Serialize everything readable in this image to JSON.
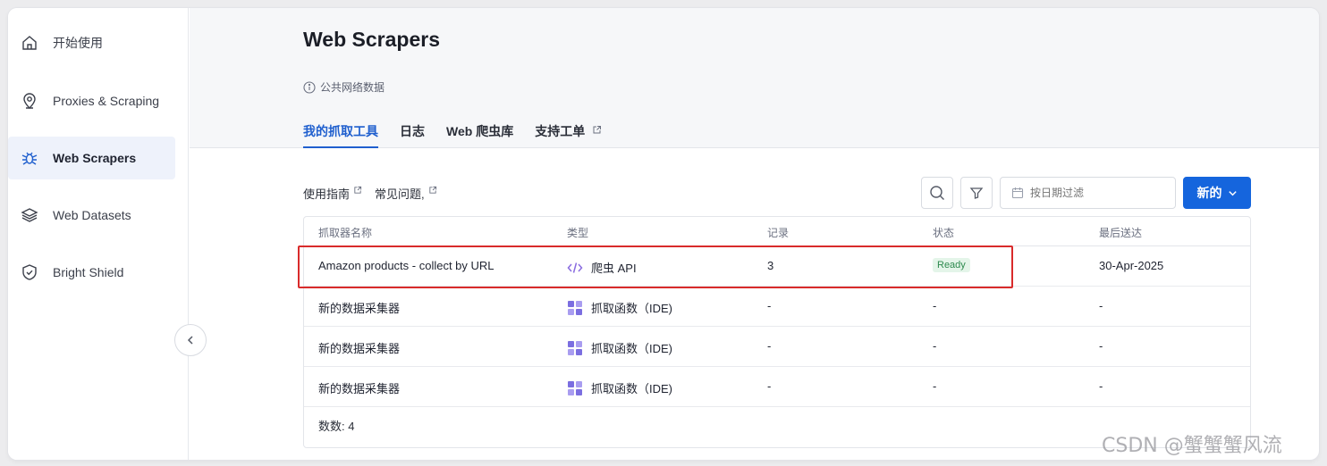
{
  "sidebar": {
    "items": [
      {
        "label": "开始使用",
        "icon": "home-icon"
      },
      {
        "label": "Proxies & Scraping",
        "icon": "location-pin-icon"
      },
      {
        "label": "Web Scrapers",
        "icon": "spider-icon",
        "active": true
      },
      {
        "label": "Web Datasets",
        "icon": "layers-icon"
      },
      {
        "label": "Bright Shield",
        "icon": "shield-check-icon"
      }
    ]
  },
  "header": {
    "title": "Web Scrapers",
    "subtitle": "公共网络数据",
    "tabs": [
      {
        "label": "我的抓取工具",
        "active": true
      },
      {
        "label": "日志"
      },
      {
        "label": "Web 爬虫库"
      },
      {
        "label": "支持工单",
        "external": true
      }
    ]
  },
  "toolbar": {
    "guide_link": "使用指南",
    "faq_link": "常见问题,",
    "date_placeholder": "按日期过滤",
    "new_button": "新的"
  },
  "table": {
    "columns": [
      "抓取器名称",
      "类型",
      "记录",
      "状态",
      "最后送达"
    ],
    "rows": [
      {
        "name": "Amazon products - collect by URL",
        "type": "爬虫 API",
        "type_icon": "code-icon",
        "records": "3",
        "status": "Ready",
        "last_delivered": "30-Apr-2025"
      },
      {
        "name": "新的数据采集器",
        "type": "抓取函数（IDE)",
        "type_icon": "grid-icon",
        "records": "-",
        "status": "-",
        "last_delivered": "-"
      },
      {
        "name": "新的数据采集器",
        "type": "抓取函数（IDE)",
        "type_icon": "grid-icon",
        "records": "-",
        "status": "-",
        "last_delivered": "-"
      },
      {
        "name": "新的数据采集器",
        "type": "抓取函数（IDE)",
        "type_icon": "grid-icon",
        "records": "-",
        "status": "-",
        "last_delivered": "-"
      }
    ],
    "count": "数数: 4"
  },
  "colors": {
    "accent": "#1565dd",
    "active_tab": "#1f5fce",
    "ready_badge": "#2d8a4e",
    "highlight": "#d92b2b"
  },
  "watermark": "CSDN @蟹蟹蟹风流"
}
